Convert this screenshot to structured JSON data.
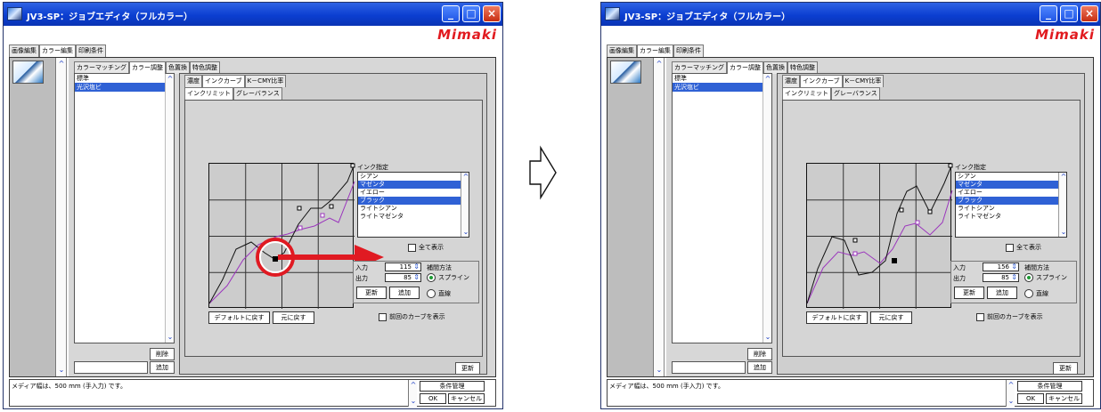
{
  "window": {
    "title": "JV3-SP：ジョブエディタ（フルカラー）",
    "brand": "Mimaki"
  },
  "top_tabs": [
    "画像編集",
    "カラー編集",
    "印刷条件"
  ],
  "sub_tabs": [
    "カラーマッチング",
    "カラー調整",
    "色置換",
    "特色調整"
  ],
  "left_list": {
    "items": [
      "標準",
      "光沢塩ビ"
    ],
    "selected": 1,
    "delete_button": "削除",
    "add_button": "追加"
  },
  "adjust": {
    "tabs": [
      "濃度",
      "インクカーブ",
      "K－CMY比率"
    ],
    "inner_tabs": [
      "インクリミット",
      "グレーバランス"
    ],
    "update_button": "更新",
    "default_button": "デフォルトに戻す",
    "revert_button": "元に戻す"
  },
  "ink": {
    "label": "インク指定",
    "items": [
      "シアン",
      "マゼンタ",
      "イエロー",
      "ブラック",
      "ライトシアン",
      "ライトマゼンタ"
    ],
    "selected": [
      1,
      3
    ],
    "show_all": "全て表示",
    "input_label": "入力",
    "output_label": "出力",
    "interpolation_label": "補間方法",
    "spline": "スプライン",
    "straight": "直線",
    "update": "更新",
    "add": "追加",
    "previous_curve": "前回のカーブを表示"
  },
  "states": [
    {
      "input_value": "115",
      "output_value": "85"
    },
    {
      "input_value": "156",
      "output_value": "85"
    }
  ],
  "status": {
    "message": "メディア幅は、500 mm (手入力) です。",
    "condition_button": "条件管理",
    "ok_button": "OK",
    "cancel_button": "キャンセル"
  },
  "colors": {
    "title_blue": "#0b3ed1",
    "selection_blue": "#2f61d5",
    "mimaki_red": "#e11a1f",
    "highlight_red": "#e01a22",
    "magenta_curve": "#9b35bd"
  },
  "icons": [
    "app-icon",
    "minimize-icon",
    "maximize-icon",
    "close-icon",
    "right-arrow-icon"
  ]
}
